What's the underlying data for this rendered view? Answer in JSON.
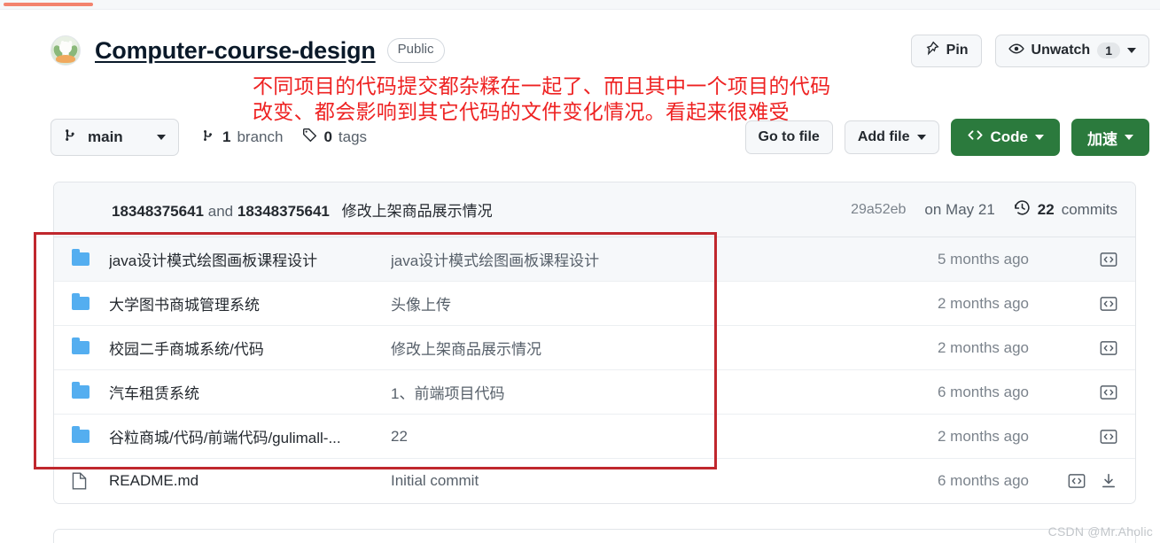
{
  "topbar": {
    "progress_percent": 8,
    "accent_color": "#f3836e"
  },
  "header": {
    "avatar_name": "repository-owner-avatar",
    "repo_name": "Computer-course-design",
    "visibility": "Public",
    "actions": {
      "pin_label": "Pin",
      "watch_label": "Unwatch",
      "watch_count": "1"
    }
  },
  "annotation": {
    "line1": "不同项目的代码提交都杂糅在一起了、而且其中一个项目的代码",
    "line2": "改变、都会影响到其它代码的文件变化情况。看起来很难受",
    "color": "#ee2222",
    "box_color": "#c0272d"
  },
  "toolbar": {
    "branch_label": "main",
    "branch_count": "1",
    "branch_word": "branch",
    "tag_count": "0",
    "tag_word": "tags",
    "go_to_file_label": "Go to file",
    "add_file_label": "Add file",
    "code_label": "Code",
    "accelerate_label": "加速",
    "green_color": "#2b7a3d"
  },
  "commit_bar": {
    "author": "18348375641",
    "and_word": "and",
    "coauthor": "18348375641",
    "message": "修改上架商品展示情况",
    "sha": "29a52eb",
    "date": "on May 21",
    "commit_count": "22",
    "commits_word": "commits"
  },
  "files": {
    "rows": [
      {
        "type": "folder",
        "name": "java设计模式绘图画板课程设计",
        "message": "java设计模式绘图画板课程设计",
        "age": "5 months ago",
        "highlighted": true,
        "has_download": false
      },
      {
        "type": "folder",
        "name": "大学图书商城管理系统",
        "message": "头像上传",
        "age": "2 months ago",
        "highlighted": false,
        "has_download": false
      },
      {
        "type": "folder",
        "name": "校园二手商城系统/代码",
        "message": "修改上架商品展示情况",
        "age": "2 months ago",
        "highlighted": false,
        "has_download": false
      },
      {
        "type": "folder",
        "name": "汽车租赁系统",
        "message": "1、前端项目代码",
        "age": "6 months ago",
        "highlighted": false,
        "has_download": false
      },
      {
        "type": "folder",
        "name": "谷粒商城/代码/前端代码/gulimall-...",
        "message": "22",
        "age": "2 months ago",
        "highlighted": false,
        "has_download": false
      },
      {
        "type": "file",
        "name": "README.md",
        "message": "Initial commit",
        "age": "6 months ago",
        "highlighted": false,
        "has_download": true
      }
    ]
  },
  "watermark": {
    "text": "CSDN @Mr.Aholic"
  }
}
